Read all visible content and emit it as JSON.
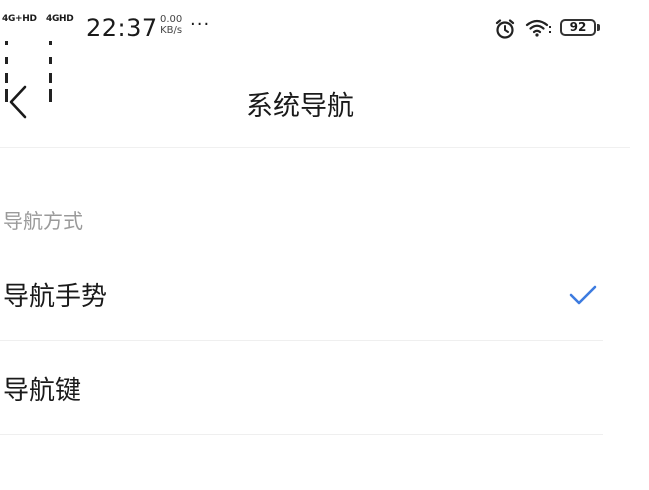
{
  "status_bar": {
    "signal1": "4G+HD",
    "signal2": "4GHD",
    "time": "22:37",
    "speed_value": "0.00",
    "speed_unit": "KB/s",
    "more": "···",
    "alarm_icon": "alarm-clock-icon",
    "wifi_icon": "wifi-icon",
    "battery": "92"
  },
  "header": {
    "back_icon": "chevron-left-icon",
    "title": "系统导航"
  },
  "section": {
    "label": "导航方式",
    "options": [
      {
        "label": "导航手势",
        "selected": true
      },
      {
        "label": "导航键",
        "selected": false
      }
    ]
  },
  "colors": {
    "accent": "#3d7be0",
    "section_label": "#9a9a9a",
    "divider": "#efefef"
  }
}
